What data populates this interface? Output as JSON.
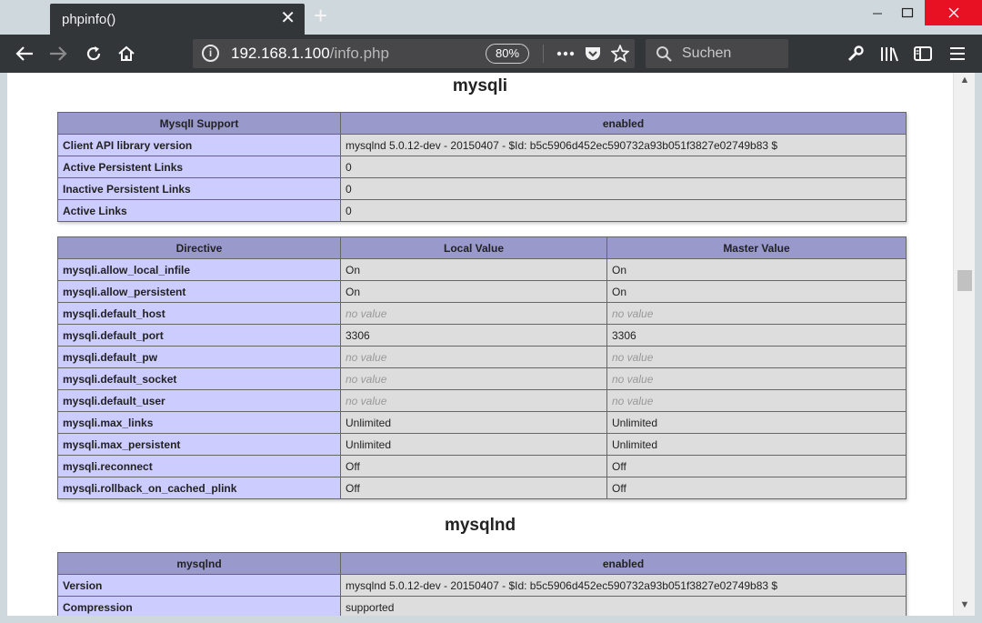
{
  "browser": {
    "tab_title": "phpinfo()",
    "tab_close_glyph": "✕",
    "new_tab_glyph": "+",
    "url_host": "192.168.1.100",
    "url_path": "/info.php",
    "zoom": "80%",
    "search_placeholder": "Suchen",
    "icons": [
      "back-icon",
      "forward-icon",
      "reload-icon",
      "home-icon",
      "info-icon",
      "more-icon",
      "pocket-icon",
      "bookmark-star-icon",
      "search-icon",
      "wrench-icon",
      "library-icon",
      "sidebar-icon",
      "menu-icon"
    ]
  },
  "content": {
    "section1_title": "mysqli",
    "support_table": {
      "header": [
        "MysqlI Support",
        "enabled"
      ],
      "rows": [
        [
          "Client API library version",
          "mysqlnd 5.0.12-dev - 20150407 - $Id: b5c5906d452ec590732a93b051f3827e02749b83 $"
        ],
        [
          "Active Persistent Links",
          "0"
        ],
        [
          "Inactive Persistent Links",
          "0"
        ],
        [
          "Active Links",
          "0"
        ]
      ]
    },
    "directive_table": {
      "header": [
        "Directive",
        "Local Value",
        "Master Value"
      ],
      "rows": [
        [
          "mysqli.allow_local_infile",
          "On",
          "On"
        ],
        [
          "mysqli.allow_persistent",
          "On",
          "On"
        ],
        [
          "mysqli.default_host",
          "no value",
          "no value"
        ],
        [
          "mysqli.default_port",
          "3306",
          "3306"
        ],
        [
          "mysqli.default_pw",
          "no value",
          "no value"
        ],
        [
          "mysqli.default_socket",
          "no value",
          "no value"
        ],
        [
          "mysqli.default_user",
          "no value",
          "no value"
        ],
        [
          "mysqli.max_links",
          "Unlimited",
          "Unlimited"
        ],
        [
          "mysqli.max_persistent",
          "Unlimited",
          "Unlimited"
        ],
        [
          "mysqli.reconnect",
          "Off",
          "Off"
        ],
        [
          "mysqli.rollback_on_cached_plink",
          "Off",
          "Off"
        ]
      ]
    },
    "section2_title": "mysqlnd",
    "mysqlnd_table": {
      "header": [
        "mysqlnd",
        "enabled"
      ],
      "rows": [
        [
          "Version",
          "mysqlnd 5.0.12-dev - 20150407 - $Id: b5c5906d452ec590732a93b051f3827e02749b83 $"
        ],
        [
          "Compression",
          "supported"
        ]
      ]
    }
  },
  "colors": {
    "header_bg": "#9999cc",
    "label_bg": "#ccccff",
    "value_bg": "#dddddd",
    "close_red": "#e81123"
  }
}
